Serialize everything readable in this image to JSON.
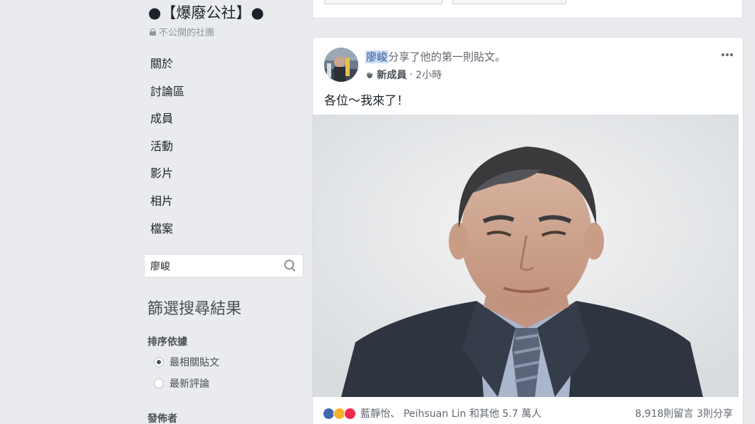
{
  "sidebar": {
    "group_name": "●【爆廢公社】●",
    "privacy_label": "不公開的社團",
    "nav_items": [
      "關於",
      "討論區",
      "成員",
      "活動",
      "影片",
      "相片",
      "檔案"
    ],
    "search": {
      "value": "廖峻",
      "icon": "search-icon"
    },
    "filter_title": "篩選搜尋結果",
    "sort_title": "排序依據",
    "sort_options": [
      {
        "label": "最相關貼文",
        "checked": true
      },
      {
        "label": "最新評論",
        "checked": false
      }
    ],
    "poster_title": "發佈者"
  },
  "post": {
    "author": "廖峻",
    "action_text": "分享了他的第一則貼文。",
    "member_badge": "新成員",
    "time": "2小時",
    "body": "各位～我來了！",
    "reaction_names": "藍靜怡、 Peihsuan Lin 和其他 5.7 萬人",
    "comments_shares": "8,918則留言  3則分享"
  },
  "colors": {
    "link": "#365899",
    "like": "#4267b2",
    "haha": "#f7b125",
    "love": "#f0284a",
    "background": "#e9ebee"
  }
}
